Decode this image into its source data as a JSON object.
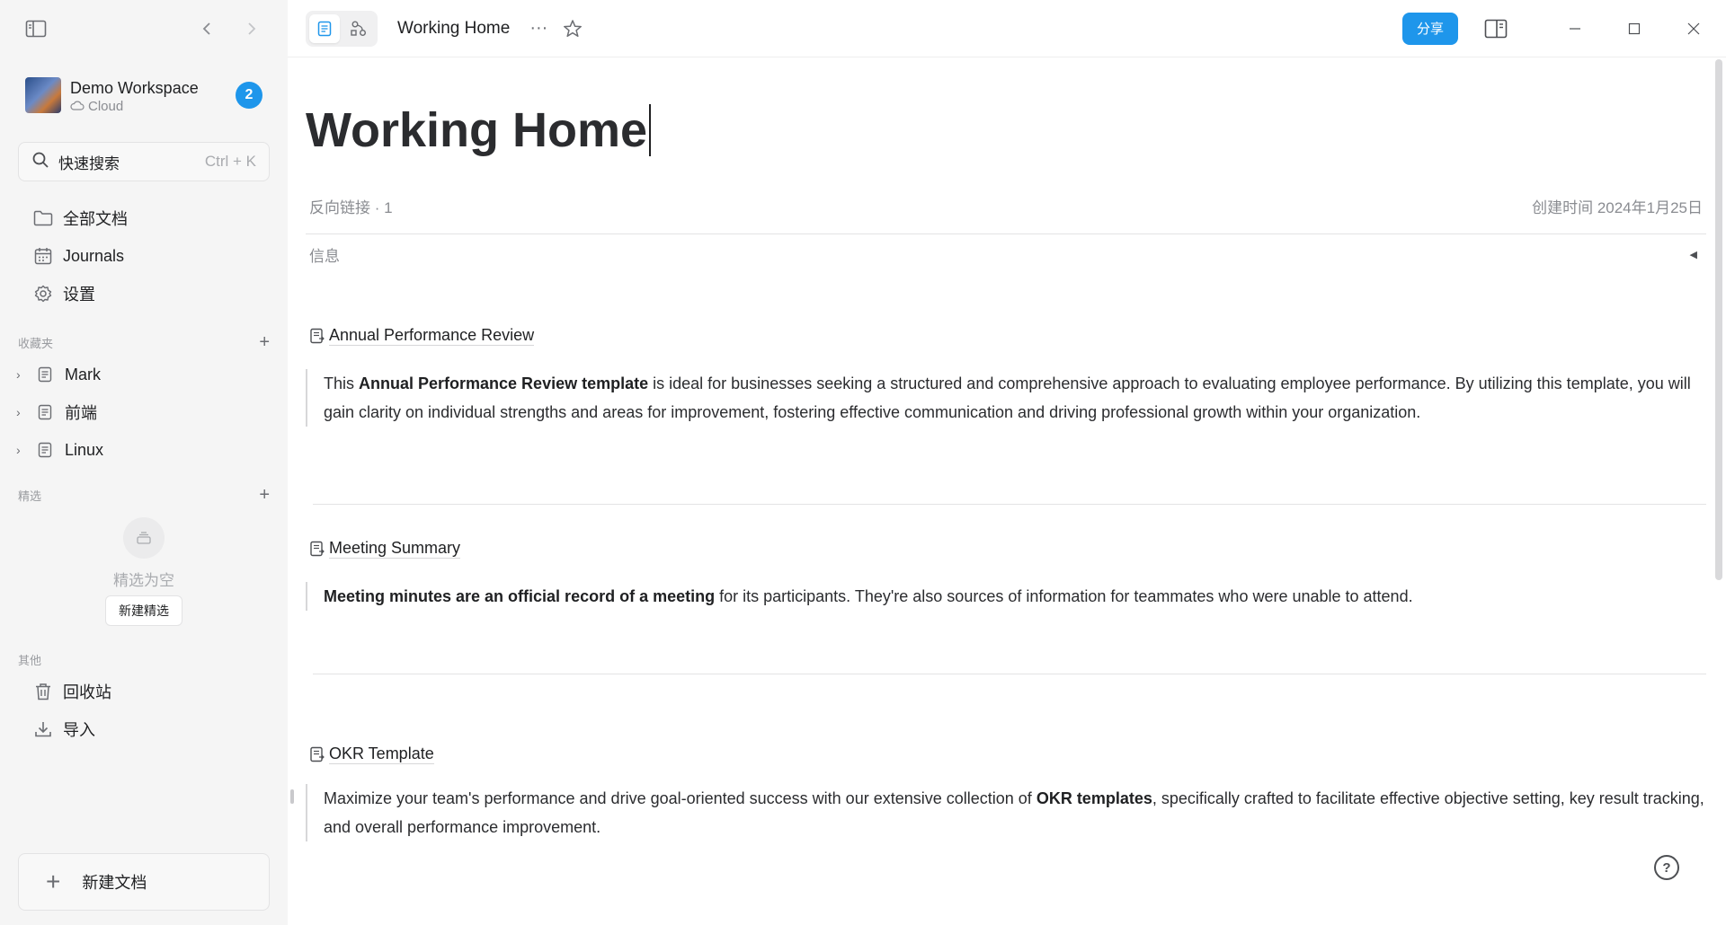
{
  "sidebar": {
    "workspace": {
      "name": "Demo Workspace",
      "type": "Cloud",
      "badge": "2"
    },
    "search": {
      "label": "快速搜索",
      "shortcut": "Ctrl + K"
    },
    "nav": [
      {
        "label": "全部文档",
        "icon": "folder-icon"
      },
      {
        "label": "Journals",
        "icon": "calendar-icon"
      },
      {
        "label": "设置",
        "icon": "gear-icon"
      }
    ],
    "favorites": {
      "title": "收藏夹",
      "items": [
        {
          "label": "Mark"
        },
        {
          "label": "前端"
        },
        {
          "label": "Linux"
        }
      ]
    },
    "featured": {
      "title": "精选",
      "empty_text": "精选为空",
      "new_label": "新建精选"
    },
    "other": {
      "title": "其他",
      "items": [
        {
          "label": "回收站",
          "icon": "trash-icon"
        },
        {
          "label": "导入",
          "icon": "download-icon"
        }
      ]
    },
    "new_doc_label": "新建文档"
  },
  "topbar": {
    "doc_title": "Working Home",
    "share_label": "分享"
  },
  "page": {
    "title": "Working Home",
    "backlinks": "反向链接 · 1",
    "created": "创建时间 2024年1月25日",
    "info_label": "信息",
    "blocks": [
      {
        "link": "Annual Performance Review",
        "pre": "This ",
        "bold": "Annual Performance Review template",
        "post": " is ideal for businesses seeking a structured and comprehensive approach to evaluating employee performance. By utilizing this template, you will gain clarity on individual strengths and areas for improvement, fostering effective communication and driving professional growth within your organization."
      },
      {
        "link": "Meeting Summary",
        "pre": "",
        "bold": "Meeting minutes are an official record of a meeting",
        "post": " for its participants. They're also sources of information for teammates who were unable to attend."
      },
      {
        "link": "OKR Template",
        "pre": "Maximize your team's performance and drive goal-oriented success with our extensive collection of ",
        "bold": "OKR templates",
        "post": ", specifically crafted to facilitate effective objective setting, key result tracking, and overall performance improvement."
      }
    ]
  },
  "colors": {
    "accent": "#1e96eb",
    "sidebar_bg": "#f5f5f5"
  }
}
